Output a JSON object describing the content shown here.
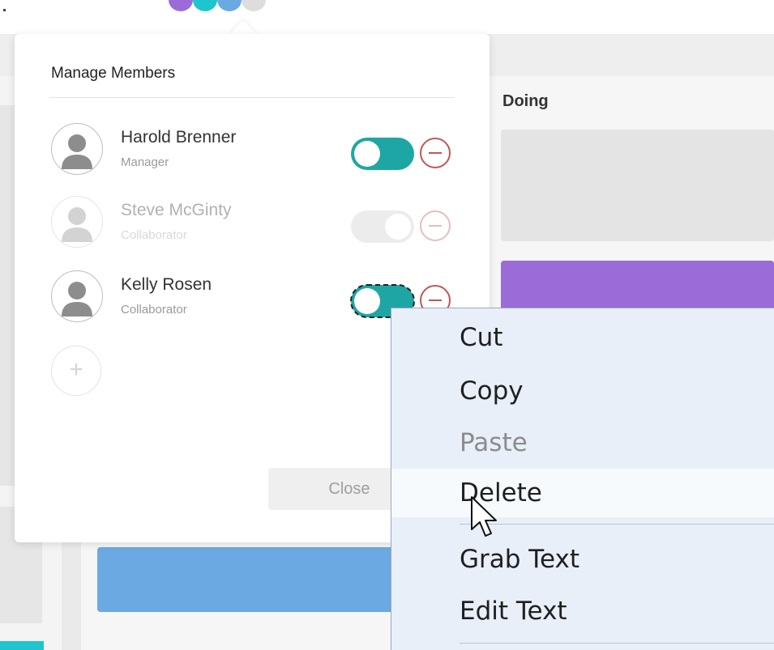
{
  "board": {
    "column_title": "Doing",
    "avatar_colors": [
      "#9b6bd8",
      "#1fc5cc",
      "#6aa9e2",
      "#dddddd"
    ]
  },
  "manage_members": {
    "title": "Manage Members",
    "members": [
      {
        "name": "Harold Brenner",
        "role": "Manager",
        "enabled": true
      },
      {
        "name": "Steve McGinty",
        "role": "Collaborator",
        "enabled": false
      },
      {
        "name": "Kelly Rosen",
        "role": "Collaborator",
        "enabled": true
      }
    ],
    "add_icon": "plus-icon",
    "remove_icon": "minus-circle-icon",
    "close_label": "Close"
  },
  "context_menu": {
    "items": [
      {
        "label": "Cut",
        "state": "normal"
      },
      {
        "label": "Copy",
        "state": "normal"
      },
      {
        "label": "Paste",
        "state": "disabled"
      },
      {
        "label": "Delete",
        "state": "hover"
      },
      {
        "label": "Grab Text",
        "state": "normal"
      },
      {
        "label": "Edit Text",
        "state": "normal"
      }
    ]
  },
  "colors": {
    "toggle_on": "#1ea6a4",
    "toggle_off": "#cfcfcf",
    "remove": "#c05656",
    "card_purple": "#9b6bd8",
    "card_blue": "#6aa9e2",
    "menu_bg": "#e9eff9"
  }
}
